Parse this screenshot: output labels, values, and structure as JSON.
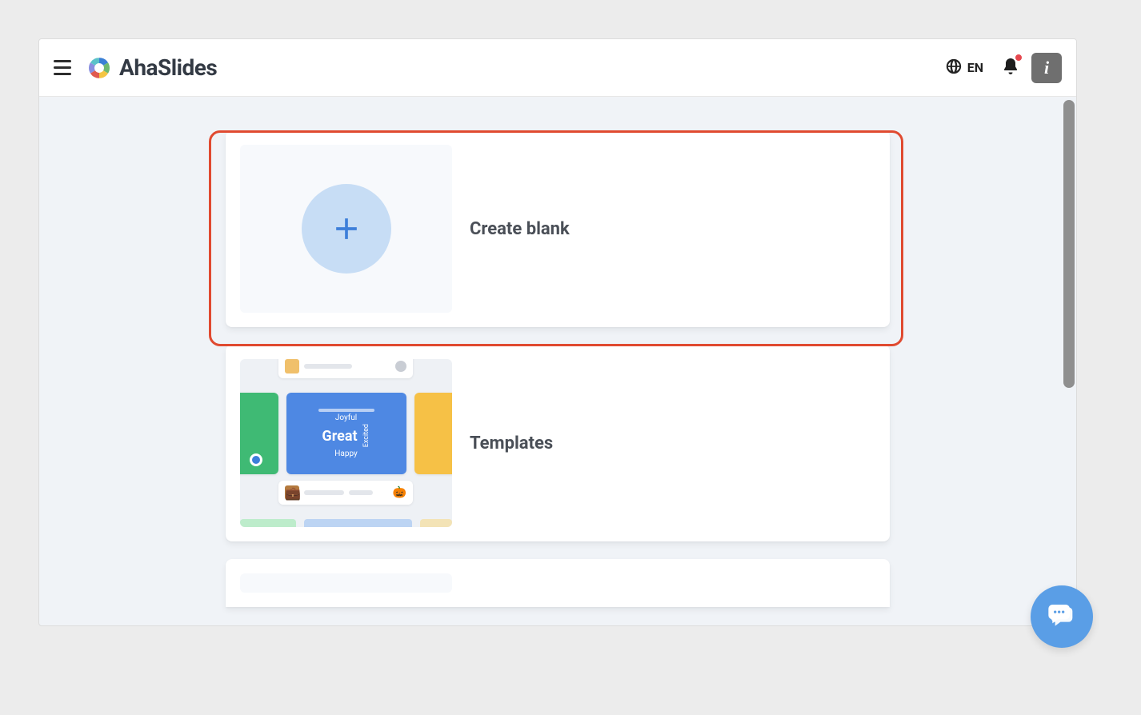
{
  "header": {
    "brand": "AhaSlides",
    "language_label": "EN"
  },
  "cards": {
    "create_blank": {
      "label": "Create blank"
    },
    "templates": {
      "label": "Templates",
      "preview_words": {
        "top": "Joyful",
        "main": "Great",
        "bottom": "Happy",
        "side": "Excited"
      }
    }
  }
}
